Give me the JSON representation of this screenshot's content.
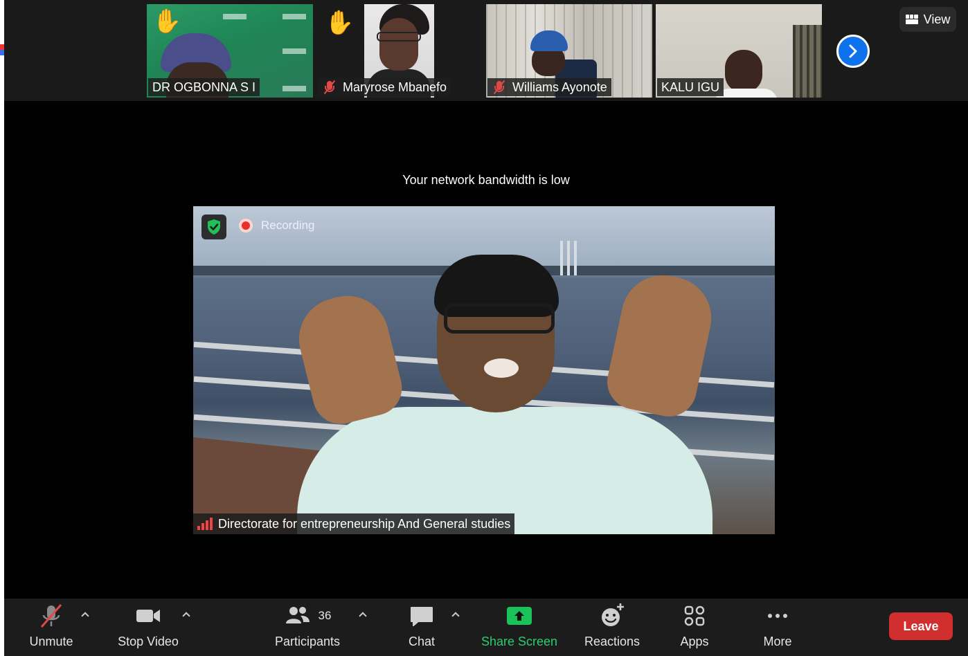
{
  "thumbnails": [
    {
      "name": "DR OGBONNA S I",
      "muted": false,
      "hand_raised": true
    },
    {
      "name": "Maryrose Mbanefo",
      "muted": true,
      "hand_raised": true
    },
    {
      "name": "Williams Ayonote",
      "muted": true,
      "hand_raised": false
    },
    {
      "name": "KALU IGU",
      "muted": false,
      "hand_raised": false
    }
  ],
  "view_button": {
    "label": "View",
    "icon": "grid-icon"
  },
  "next_page_icon": "chevron-right-icon",
  "network_message": "Your network bandwidth is low",
  "speaker": {
    "recording_label": "Recording",
    "name": "Directorate for entrepreneurship And General studies",
    "security_icon": "shield-check-icon"
  },
  "toolbar": {
    "unmute": {
      "label": "Unmute",
      "icon": "mic-off-icon"
    },
    "video": {
      "label": "Stop Video",
      "icon": "video-camera-icon"
    },
    "participants": {
      "label": "Participants",
      "count": "36",
      "icon": "people-icon"
    },
    "chat": {
      "label": "Chat",
      "icon": "chat-bubble-icon"
    },
    "share": {
      "label": "Share Screen",
      "icon": "share-arrow-icon"
    },
    "reactions": {
      "label": "Reactions",
      "icon": "smiley-plus-icon"
    },
    "apps": {
      "label": "Apps",
      "icon": "apps-icon"
    },
    "more": {
      "label": "More",
      "icon": "more-dots-icon"
    },
    "leave": {
      "label": "Leave"
    }
  },
  "colors": {
    "accent_blue": "#0e72ed",
    "share_green": "#19c35a",
    "leave_red": "#d12f2f",
    "muted_red": "#e34848"
  }
}
